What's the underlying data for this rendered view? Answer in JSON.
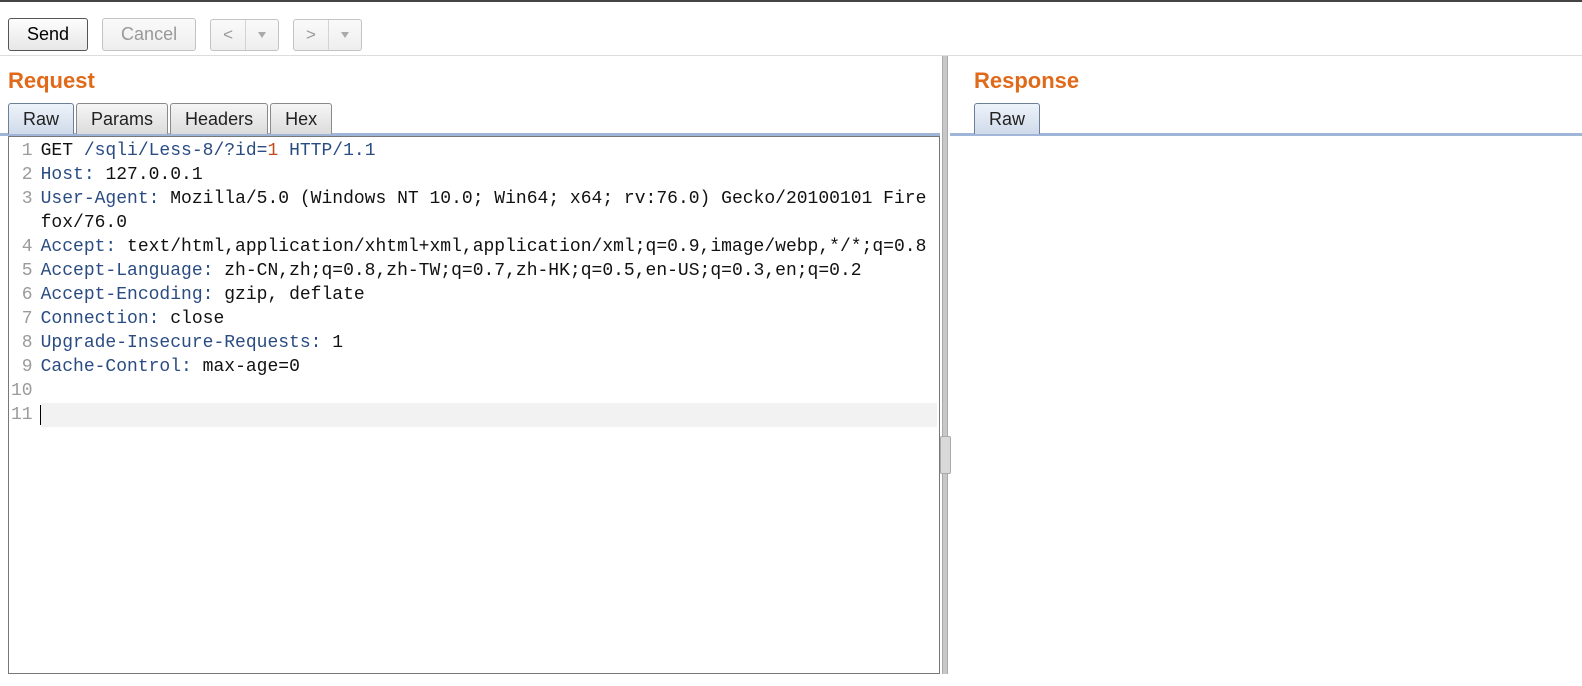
{
  "toolbar": {
    "send_label": "Send",
    "cancel_label": "Cancel",
    "back_symbol": "<",
    "forward_symbol": ">"
  },
  "request": {
    "title": "Request",
    "tabs": [
      "Raw",
      "Params",
      "Headers",
      "Hex"
    ],
    "active_tab": 0,
    "editor": {
      "method": "GET",
      "path": " /sqli/Less-8/?",
      "param_name": "id",
      "equals": "=",
      "param_value": "1",
      "protocol": " HTTP/1.1",
      "headers": [
        {
          "name": "Host",
          "value": " 127.0.0.1"
        },
        {
          "name": "User-Agent",
          "value": " Mozilla/5.0 (Windows NT 10.0; Win64; x64; rv:76.0) Gecko/20100101 Firefox/76.0"
        },
        {
          "name": "Accept",
          "value": " text/html,application/xhtml+xml,application/xml;q=0.9,image/webp,*/*;q=0.8"
        },
        {
          "name": "Accept-Language",
          "value": " zh-CN,zh;q=0.8,zh-TW;q=0.7,zh-HK;q=0.5,en-US;q=0.3,en;q=0.2"
        },
        {
          "name": "Accept-Encoding",
          "value": " gzip, deflate"
        },
        {
          "name": "Connection",
          "value": " close"
        },
        {
          "name": "Upgrade-Insecure-Requests",
          "value": " 1"
        },
        {
          "name": "Cache-Control",
          "value": " max-age=0"
        }
      ],
      "line_numbers": [
        "1",
        "2",
        "3",
        "",
        "4",
        "5",
        "6",
        "7",
        "8",
        "9",
        "10",
        "11"
      ],
      "total_lines": 11
    }
  },
  "response": {
    "title": "Response",
    "tabs": [
      "Raw"
    ],
    "active_tab": 0
  }
}
